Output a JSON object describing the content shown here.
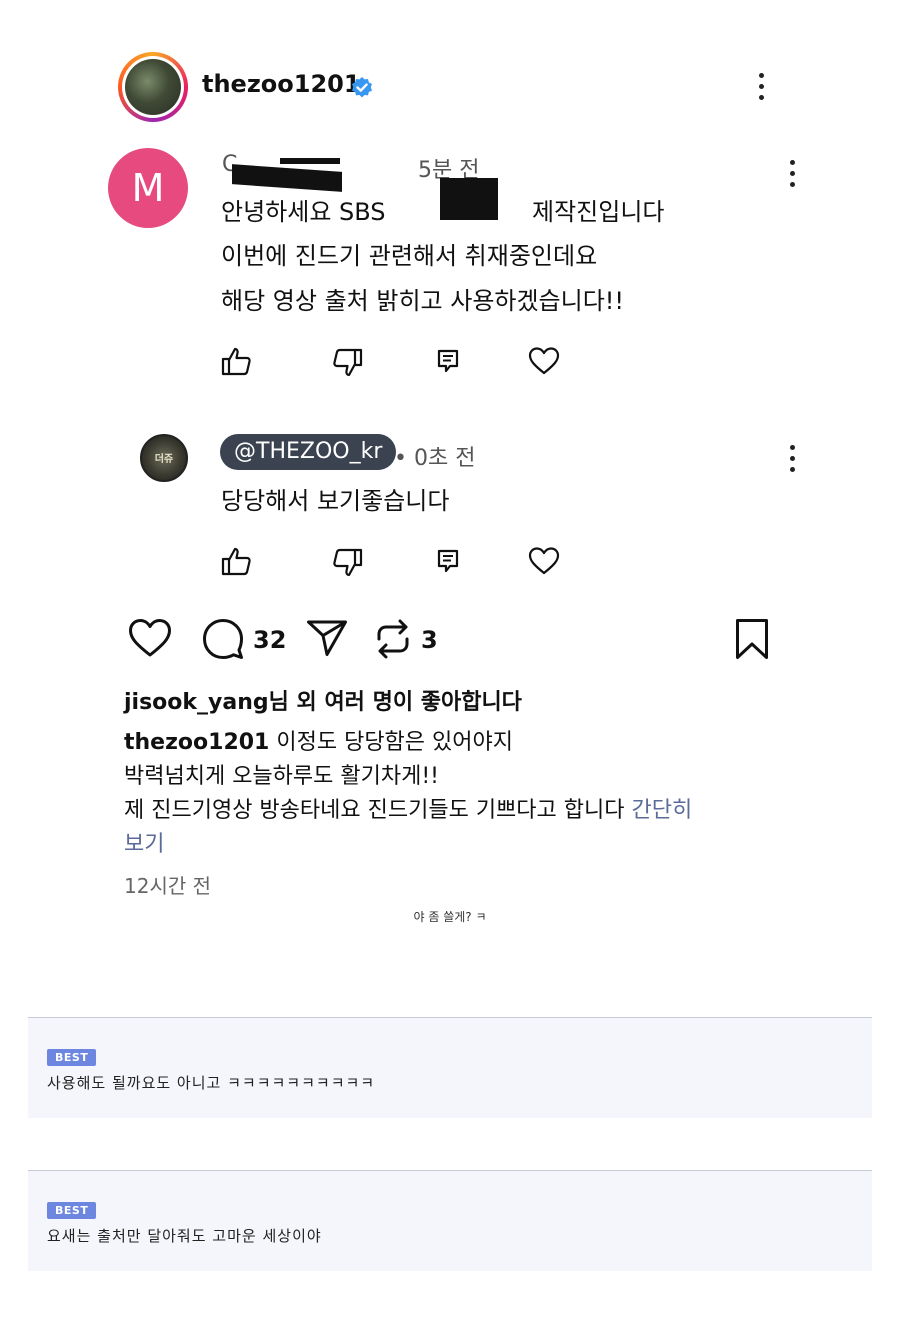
{
  "post": {
    "username": "thezoo1201",
    "verified_icon": "verified-badge-icon",
    "menu_icon": "kebab-menu-icon"
  },
  "comment": {
    "avatar_letter": "M",
    "avatar_color": "#e64a7f",
    "author_partial": "C",
    "time": "5분 전",
    "line1_prefix": "안녕하세요 SBS",
    "line1_suffix": "제작진입니다",
    "line2": "이번에 진드기 관련해서 취재중인데요",
    "line3": "해당 영상 출처 밝히고 사용하겠습니다!!",
    "actions": [
      "thumbs-up-icon",
      "thumbs-down-icon",
      "reply-icon",
      "heart-icon"
    ]
  },
  "reply": {
    "handle": "@THEZOO_kr",
    "time": "• 0초 전",
    "text": "당당해서 보기좋습니다",
    "avatar_label": "더쥬",
    "actions": [
      "thumbs-up-icon",
      "thumbs-down-icon",
      "reply-icon",
      "heart-icon"
    ]
  },
  "ig": {
    "comment_count": "32",
    "repost_count": "3",
    "likes_user": "jisook_yang",
    "likes_text": "님 외 여러 명이 좋아합니다",
    "caption_user": "thezoo1201",
    "caption_line1": " 이정도 당당함은 있어야지",
    "caption_line2": "박력넘치게 오늘하루도 활기차게!!",
    "caption_line3": "제 진드기영상 방송타네요 진드기들도 기쁘다고 합니다",
    "more_label": "간단히",
    "more_label2": "보기",
    "time": "12시간 전"
  },
  "note": "야 좀 쓸게? ㅋ",
  "best_comments": [
    {
      "badge": "BEST",
      "text": "사용해도 될까요도 아니고 ㅋㅋㅋㅋㅋㅋㅋㅋㅋㅋ"
    },
    {
      "badge": "BEST",
      "text": "요새는 출처만 달아줘도 고마운 세상이야"
    }
  ],
  "colors": {
    "accent_link": "#5a6b9a",
    "best_badge": "#6d86df",
    "handle_pill": "#3b4350"
  }
}
